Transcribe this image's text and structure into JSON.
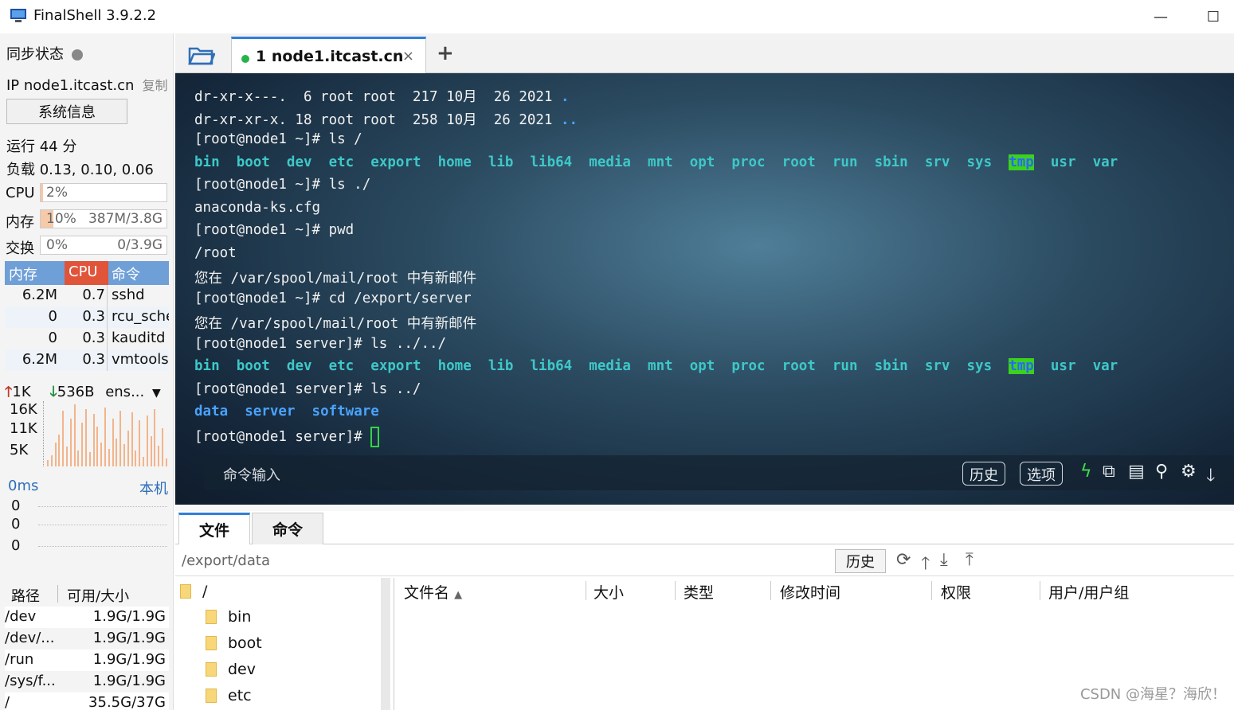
{
  "window": {
    "title": "FinalShell 3.9.2.2",
    "minimize_glyph": "—",
    "maximize_glyph": "☐"
  },
  "left": {
    "sync_label": "同步状态",
    "ip_label": "IP node1.itcast.cn",
    "copy_label": "复制",
    "sysinfo_button": "系统信息",
    "uptime": "运行 44 分",
    "load": "负载 0.13, 0.10, 0.06",
    "cpu": {
      "label": "CPU",
      "value": "2%"
    },
    "mem": {
      "label": "内存",
      "value": "10%",
      "detail": "387M/3.8G"
    },
    "swap": {
      "label": "交换",
      "value": "0%",
      "detail": "0/3.9G"
    },
    "proc_headers": [
      "内存",
      "CPU",
      "命令"
    ],
    "processes": [
      {
        "mem": "6.2M",
        "cpu": "0.7",
        "cmd": "sshd"
      },
      {
        "mem": "0",
        "cpu": "0.3",
        "cmd": "rcu_sche"
      },
      {
        "mem": "0",
        "cpu": "0.3",
        "cmd": "kauditd"
      },
      {
        "mem": "6.2M",
        "cpu": "0.3",
        "cmd": "vmtoolsd"
      }
    ],
    "net": {
      "up": "1K",
      "down": "536B",
      "iface": "ens..."
    },
    "graph_labels": [
      "16K",
      "11K",
      "5K"
    ],
    "ping": {
      "latency": "0ms",
      "target": "本机",
      "values": [
        "0",
        "0",
        "0"
      ]
    },
    "disk_headers": [
      "路径",
      "可用/大小"
    ],
    "disks": [
      {
        "path": "/dev",
        "size": "1.9G/1.9G"
      },
      {
        "path": "/dev/...",
        "size": "1.9G/1.9G"
      },
      {
        "path": "/run",
        "size": "1.9G/1.9G"
      },
      {
        "path": "/sys/f...",
        "size": "1.9G/1.9G"
      },
      {
        "path": "/",
        "size": "35.5G/37G"
      }
    ]
  },
  "tabs": {
    "session": "1 node1.itcast.cn",
    "close": "×",
    "add": "+"
  },
  "terminal": {
    "l1": "dr-xr-x---.  6 root root  217 10月  26 2021 ",
    "l1_dot": ".",
    "l2": "dr-xr-xr-x. 18 root root  258 10月  26 2021 ",
    "l2_dot": "..",
    "l3": "[root@node1 ~]# ls /",
    "root_dirs": [
      "bin",
      "boot",
      "dev",
      "etc",
      "export",
      "home",
      "lib",
      "lib64",
      "media",
      "mnt",
      "opt",
      "proc",
      "root",
      "run",
      "sbin",
      "srv",
      "sys",
      "tmp",
      "usr",
      "var"
    ],
    "l5": "[root@node1 ~]# ls ./",
    "l6": "anaconda-ks.cfg",
    "l7": "[root@node1 ~]# pwd",
    "l8": "/root",
    "l9": "您在 /var/spool/mail/root 中有新邮件",
    "l10": "[root@node1 ~]# cd /export/server",
    "l11": "您在 /var/spool/mail/root 中有新邮件",
    "l12": "[root@node1 server]# ls ../../",
    "l14": "[root@node1 server]# ls ../",
    "export_dirs": [
      "data",
      "server",
      "software"
    ],
    "l16": "[root@node1 server]# ",
    "cmd_placeholder": "命令输入",
    "btn_history": "历史",
    "btn_options": "选项"
  },
  "bottom": {
    "tab_files": "文件",
    "tab_commands": "命令",
    "path": "/export/data",
    "history_btn": "历史",
    "tree_root": "/",
    "tree": [
      "bin",
      "boot",
      "dev",
      "etc"
    ],
    "columns": [
      "文件名",
      "大小",
      "类型",
      "修改时间",
      "权限",
      "用户/用户组"
    ],
    "sort_glyph": "▲"
  },
  "watermark": "CSDN @海星？海欣！"
}
